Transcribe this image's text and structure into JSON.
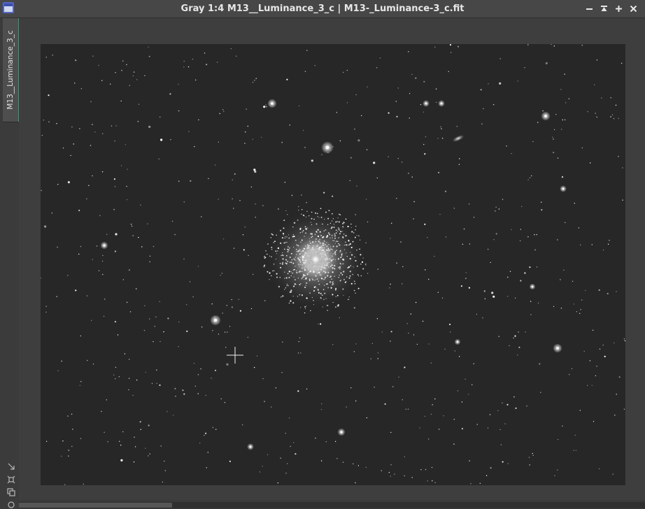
{
  "window": {
    "title": "Gray 1:4 M13__Luminance_3_c | M13-_Luminance-3_c.fit",
    "icons": [
      "app-window-icon",
      "minimize-icon",
      "shade-icon",
      "maximize-icon",
      "close-icon"
    ]
  },
  "view_tab": {
    "label": "M13__Luminance_3_c"
  },
  "tools": {
    "icons": [
      "fit-view-icon",
      "zoom-to-fit-icon",
      "clone-view-icon"
    ]
  },
  "colors": {
    "active_tab_accent": "#2e9e6f",
    "title_bar": "#474747",
    "image_sky": "#272727"
  }
}
